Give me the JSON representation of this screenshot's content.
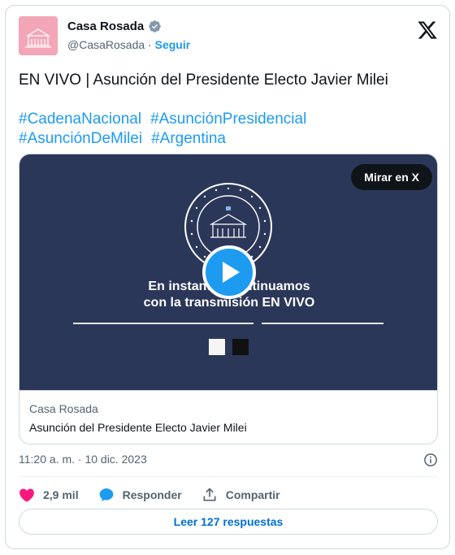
{
  "author": {
    "name": "Casa Rosada",
    "handle": "@CasaRosada",
    "separator": "·",
    "follow_label": "Seguir"
  },
  "tweet": {
    "text": "EN VIVO | Asunción del Presidente Electo Javier Milei",
    "hashtags": [
      "#CadenaNacional",
      "#AsunciónPresidencial",
      "#AsunciónDeMilei",
      "#Argentina"
    ]
  },
  "media": {
    "watch_label": "Mirar en X",
    "caption_line1": "En instantes continuamos",
    "caption_line2": "con la transmisión EN VIVO",
    "source": "Casa Rosada",
    "title": "Asunción del Presidente Electo Javier Milei"
  },
  "timestamp": "11:20 a. m. · 10 dic. 2023",
  "actions": {
    "likes_count": "2,9 mil",
    "reply_label": "Responder",
    "share_label": "Compartir"
  },
  "replies_button": "Leer 127 respuestas",
  "colors": {
    "link": "#1d9bf0",
    "video_bg": "#2b3759",
    "heart": "#f91880",
    "avatar_bg": "#f3a6b8"
  }
}
